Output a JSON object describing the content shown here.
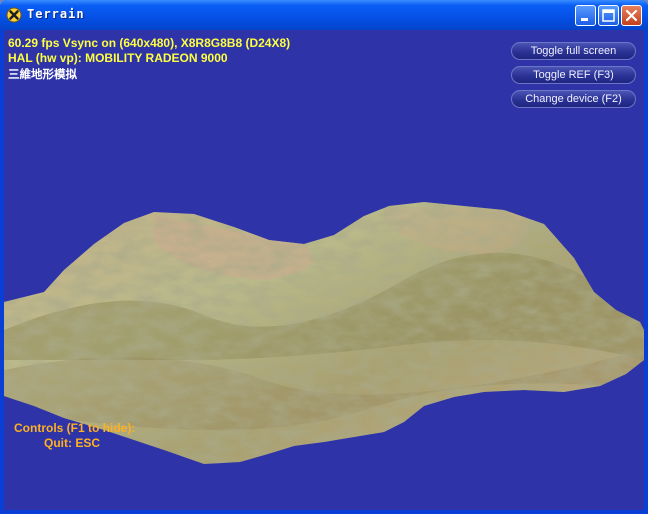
{
  "window": {
    "title": "Terrain",
    "app_icon": "directx-x-icon",
    "controls": [
      "minimize-icon",
      "maximize-icon",
      "close-icon"
    ]
  },
  "stats": {
    "fps_line": "60.29 fps Vsync on (640x480), X8R8G8B8 (D24X8)",
    "device_line": "HAL (hw vp): MOBILITY RADEON 9000",
    "caption": "三維地形模拟"
  },
  "buttons": {
    "toggle_fullscreen": "Toggle full screen",
    "toggle_ref": "Toggle REF (F3)",
    "change_device": "Change device (F2)"
  },
  "help": {
    "controls": "Controls (F1 to hide):",
    "quit": "Quit: ESC"
  },
  "colors": {
    "viewport_bg": "#2e34a8",
    "stats_text": "#ffff40",
    "help_text": "#ffb020",
    "titlebar": "#0550e6"
  }
}
